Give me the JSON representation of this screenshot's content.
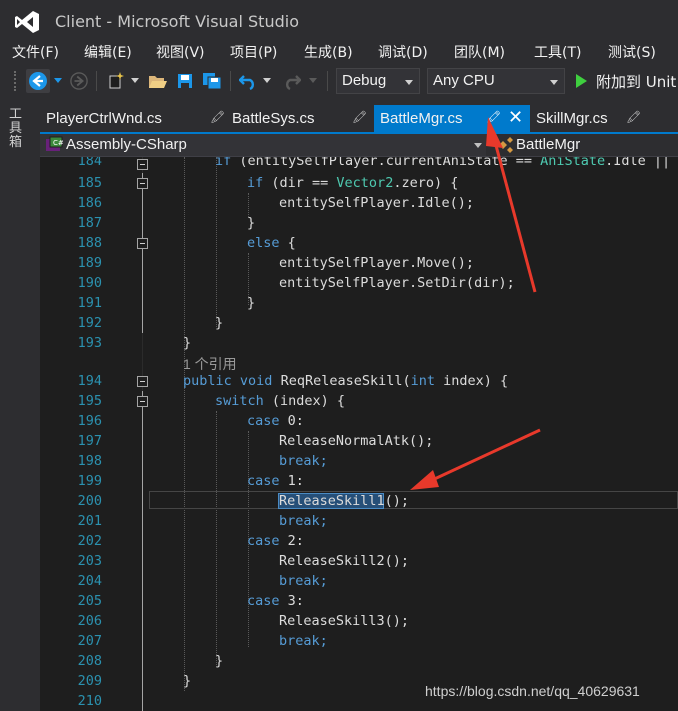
{
  "window": {
    "title": "Client - Microsoft Visual Studio"
  },
  "menu": [
    "文件(F)",
    "编辑(E)",
    "视图(V)",
    "项目(P)",
    "生成(B)",
    "调试(D)",
    "团队(M)",
    "工具(T)",
    "测试(S)"
  ],
  "toolbar": {
    "config": "Debug",
    "platform": "Any CPU",
    "attach_label": "附加到 Unit"
  },
  "toolbox_label": "工具箱",
  "tabs": [
    {
      "label": "PlayerCtrlWnd.cs",
      "active": false
    },
    {
      "label": "BattleSys.cs",
      "active": false
    },
    {
      "label": "BattleMgr.cs",
      "active": true
    },
    {
      "label": "SkillMgr.cs",
      "active": false
    }
  ],
  "navbar": {
    "project": "Assembly-CSharp",
    "class": "BattleMgr"
  },
  "editor": {
    "line_numbers": [
      "184",
      "185",
      "186",
      "187",
      "188",
      "189",
      "190",
      "191",
      "192",
      "193",
      "194",
      "195",
      "196",
      "197",
      "198",
      "199",
      "200",
      "201",
      "202",
      "203",
      "204",
      "205",
      "206",
      "207",
      "208",
      "209",
      "210"
    ],
    "codelens": "1 个引用",
    "lines": {
      "l184": "if (entitySelfPlayer.currentAniState == AniState.Idle || e",
      "l185a": "if",
      "l185b": " (dir == ",
      "l185c": "Vector2",
      "l185d": ".zero) {",
      "l186": "entitySelfPlayer.Idle();",
      "l187": "}",
      "l188a": "else",
      "l188b": " {",
      "l189": "entitySelfPlayer.Move();",
      "l190": "entitySelfPlayer.SetDir(dir);",
      "l191": "}",
      "l192": "}",
      "l193": "}",
      "l194a": "public",
      "l194b": "void",
      "l194c": " ReqReleaseSkill(",
      "l194d": "int",
      "l194e": " index) {",
      "l195a": "switch",
      "l195b": " (index) {",
      "l196a": "case",
      "l196b": " 0:",
      "l197": "ReleaseNormalAtk();",
      "l198": "break;",
      "l199a": "case",
      "l199b": " 1:",
      "l200a": "ReleaseSkill1",
      "l200b": "();",
      "l201": "break;",
      "l202a": "case",
      "l202b": " 2:",
      "l203": "ReleaseSkill2();",
      "l204": "break;",
      "l205a": "case",
      "l205b": " 3:",
      "l206": "ReleaseSkill3();",
      "l207": "break;",
      "l208": "}",
      "l209": "}"
    }
  },
  "watermark": "https://blog.csdn.net/qq_40629631",
  "colors": {
    "accent": "#007acc",
    "annotation_arrow": "#e8392b"
  }
}
